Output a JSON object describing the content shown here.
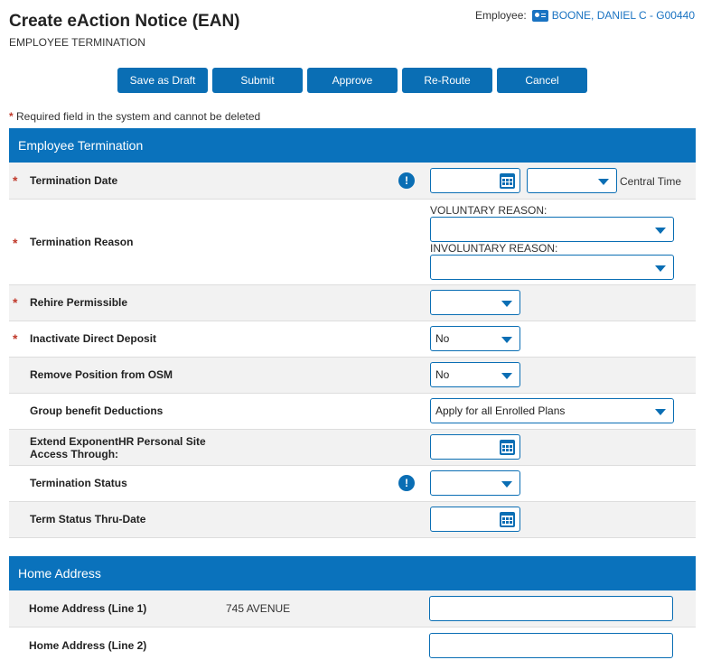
{
  "header": {
    "title": "Create eAction Notice (EAN)",
    "subtitle": "EMPLOYEE TERMINATION",
    "employee_label": "Employee:",
    "employee_icon": "id-card-icon",
    "employee_name": "BOONE, DANIEL C - G00440"
  },
  "toolbar": {
    "save_draft": "Save as Draft",
    "submit": "Submit",
    "approve": "Approve",
    "reroute": "Re-Route",
    "cancel": "Cancel"
  },
  "required_note": "Required field in the system and cannot be deleted",
  "sections": {
    "termination": {
      "title": "Employee Termination",
      "termination_date": {
        "label": "Termination Date",
        "date_value": "",
        "time_value": "",
        "timezone": "Central Time"
      },
      "termination_reason": {
        "label": "Termination Reason",
        "voluntary_label": "VOLUNTARY REASON:",
        "voluntary_value": "",
        "involuntary_label": "INVOLUNTARY REASON:",
        "involuntary_value": ""
      },
      "rehire": {
        "label": "Rehire Permissible",
        "value": ""
      },
      "direct_deposit": {
        "label": "Inactivate Direct Deposit",
        "value": "No"
      },
      "remove_position": {
        "label": "Remove Position from OSM",
        "value": "No"
      },
      "group_benefit": {
        "label": "Group benefit Deductions",
        "value": "Apply for all Enrolled Plans"
      },
      "extend_access": {
        "label_line1": "Extend ExponentHR Personal Site",
        "label_line2": "Access Through:",
        "value": ""
      },
      "termination_status": {
        "label": "Termination Status",
        "value": ""
      },
      "term_status_thru": {
        "label": "Term Status Thru-Date",
        "value": ""
      }
    },
    "home_address": {
      "title": "Home Address",
      "line1": {
        "label": "Home Address (Line 1)",
        "current": "745 AVENUE",
        "value": ""
      },
      "line2": {
        "label": "Home Address (Line 2)",
        "current": "",
        "value": ""
      }
    }
  },
  "colors": {
    "accent": "#0a6eb4",
    "required": "#c0392b",
    "header_bg": "#0a72bc"
  }
}
